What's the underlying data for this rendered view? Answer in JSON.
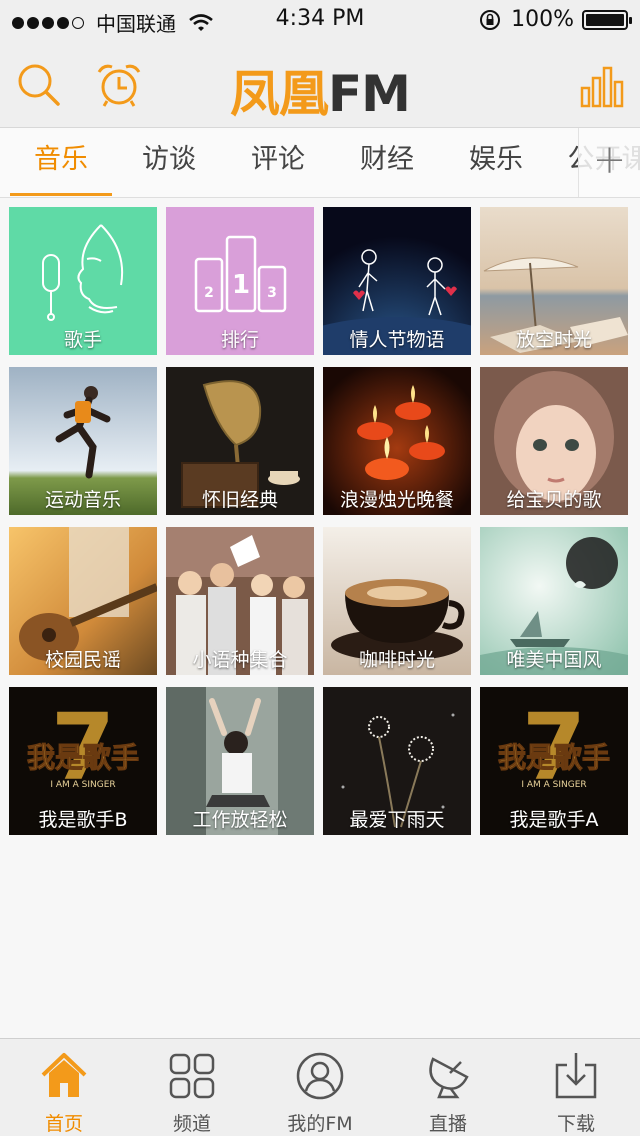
{
  "status_bar": {
    "carrier": "中国联通",
    "time": "4:34 PM",
    "battery": "100%",
    "signal_icon": "signal-dots-icon",
    "wifi_icon": "wifi-icon",
    "lock_icon": "rotation-lock-icon",
    "battery_icon": "battery-icon"
  },
  "header": {
    "logo_cn": "凤凰",
    "logo_fm": "FM",
    "search_icon": "search-icon",
    "alarm_icon": "alarm-clock-icon",
    "chart_icon": "bar-chart-icon"
  },
  "tabs": {
    "items": [
      {
        "label": "音乐",
        "active": true
      },
      {
        "label": "访谈",
        "active": false
      },
      {
        "label": "评论",
        "active": false
      },
      {
        "label": "财经",
        "active": false
      },
      {
        "label": "娱乐",
        "active": false
      },
      {
        "label": "公开课",
        "active": false
      }
    ],
    "more_label": "+"
  },
  "grid": {
    "tiles": [
      {
        "label": "歌手"
      },
      {
        "label": "排行"
      },
      {
        "label": "情人节物语"
      },
      {
        "label": "放空时光"
      },
      {
        "label": "运动音乐"
      },
      {
        "label": "怀旧经典"
      },
      {
        "label": "浪漫烛光晚餐"
      },
      {
        "label": "给宝贝的歌"
      },
      {
        "label": "校园民谣"
      },
      {
        "label": "小语种集合"
      },
      {
        "label": "咖啡时光"
      },
      {
        "label": "唯美中国风"
      },
      {
        "label": "我是歌手B"
      },
      {
        "label": "工作放轻松"
      },
      {
        "label": "最爱下雨天"
      },
      {
        "label": "我是歌手A"
      }
    ],
    "rank_numbers": [
      "2",
      "1",
      "3"
    ],
    "singer_overlay_art": "我是歌手",
    "singer_overlay_sub": "I AM A SINGER",
    "singer_number": "7"
  },
  "bottom_bar": {
    "items": [
      {
        "label": "首页",
        "icon": "home-icon",
        "active": true
      },
      {
        "label": "频道",
        "icon": "grid-icon",
        "active": false
      },
      {
        "label": "我的FM",
        "icon": "user-icon",
        "active": false
      },
      {
        "label": "直播",
        "icon": "satellite-dish-icon",
        "active": false
      },
      {
        "label": "下载",
        "icon": "download-icon",
        "active": false
      }
    ]
  },
  "colors": {
    "accent": "#f39a1a",
    "tile_singer": "#5fdaa6",
    "tile_rank": "#d99fd9"
  }
}
